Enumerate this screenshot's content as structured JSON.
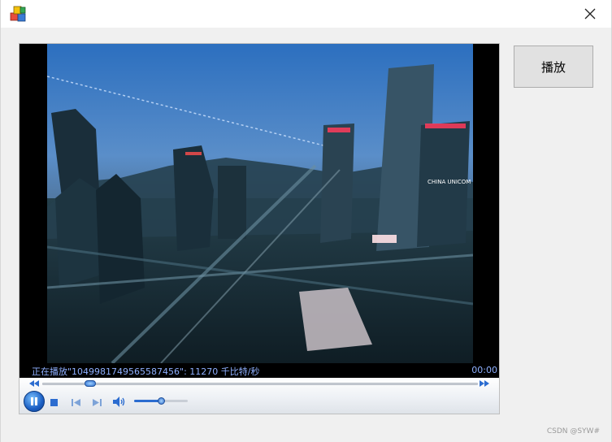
{
  "window": {
    "app_icon": "app-blocks-icon",
    "close_icon": "close-icon"
  },
  "player": {
    "status_text": "正在播放\"1049981749565587456\": 11270 千比特/秒",
    "time": "00:00",
    "seek_progress": 0.11,
    "volume_level": 0.5,
    "controls": {
      "play_pause_icon": "pause-icon",
      "stop_icon": "stop-icon",
      "previous_icon": "previous-icon",
      "next_icon": "next-icon",
      "volume_icon": "volume-icon",
      "rewind_icon": "rewind-icon",
      "fast_forward_icon": "fast-forward-icon"
    },
    "video_overlay_text": "CHINA UNICOM"
  },
  "buttons": {
    "play_label": "播放"
  },
  "watermark": "CSDN @SYW#",
  "colors": {
    "status_text": "#8fb0ff",
    "accent": "#2b6cd0"
  }
}
